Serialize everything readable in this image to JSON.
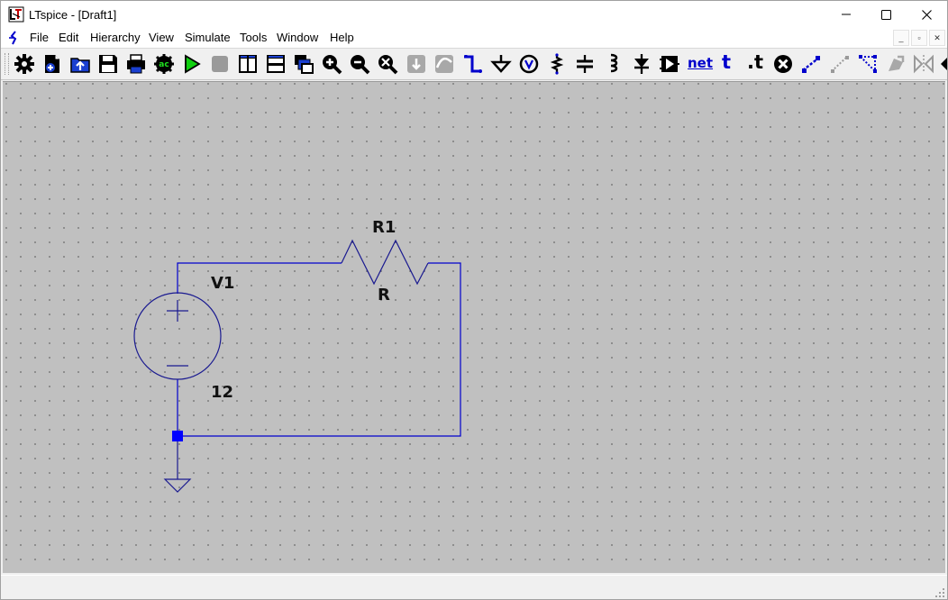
{
  "window": {
    "title": "LTspice - [Draft1]",
    "controls": {
      "minimize": "minimize-icon",
      "maximize": "maximize-icon",
      "close": "close-icon"
    }
  },
  "menubar": {
    "items": [
      "File",
      "Edit",
      "Hierarchy",
      "View",
      "Simulate",
      "Tools",
      "Window",
      "Help"
    ],
    "mdi_controls": [
      "_",
      "▫",
      "✕"
    ]
  },
  "toolbar": {
    "icons": [
      "settings-gear-icon",
      "new-schematic-icon",
      "open-folder-icon",
      "save-icon",
      "print-icon",
      "ac-analysis-icon",
      "run-icon",
      "halt-icon",
      "tile-vertical-icon",
      "tile-horizontal-icon",
      "cascade-icon",
      "zoom-in-icon",
      "zoom-out-icon",
      "zoom-fit-icon",
      "autoscale-icon",
      "waveform-icon",
      "draw-wire-icon",
      "ground-icon",
      "voltage-probe-icon",
      "resistor-icon",
      "capacitor-icon",
      "inductor-icon",
      "diode-icon",
      "component-icon",
      "label-net-icon",
      "text-icon",
      "spice-directive-icon",
      "delete-icon",
      "duplicate-icon",
      "move-icon",
      "drag-icon",
      "undo-icon",
      "rotate-icon",
      "mirror-icon"
    ],
    "net_label": "net",
    "text_label": "t",
    "directive_label": ".t",
    "ac_label": "ac"
  },
  "schematic": {
    "components": [
      {
        "ref": "V1",
        "value": "12",
        "type": "voltage-source"
      },
      {
        "ref": "R1",
        "value": "R",
        "type": "resistor"
      }
    ],
    "ground": "ground-symbol",
    "colors": {
      "wire": "#0000cc",
      "component": "#1a1a90",
      "canvas": "#c0c0c0",
      "junction": "#0000ff"
    }
  },
  "statusbar": {
    "text": ""
  }
}
